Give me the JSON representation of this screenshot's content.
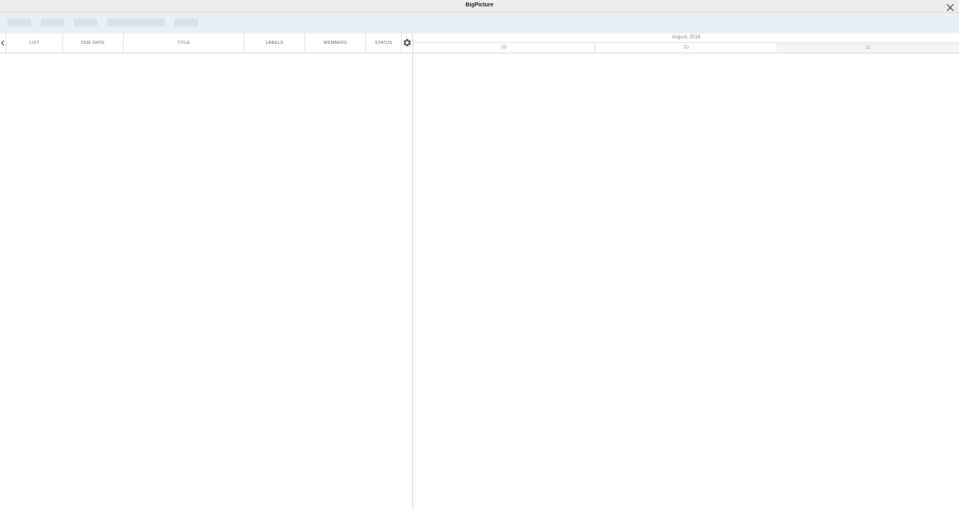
{
  "window": {
    "title": "BigPicture"
  },
  "columns": [
    "LIST",
    "DUE DATE",
    "TITLE",
    "LABELS",
    "MEMBERS",
    "STATUS"
  ],
  "timeline": {
    "month": "August, 2018",
    "days": [
      "09",
      "10",
      "11"
    ]
  },
  "icons": {
    "close": "close-icon",
    "collapse": "chevron-left-icon",
    "settings": "gear-icon"
  },
  "colors": {
    "toolbar_bg": "#e8f1f8",
    "toolbar_button": "#d6e2ed",
    "titlebar_bg": "#ededee"
  }
}
